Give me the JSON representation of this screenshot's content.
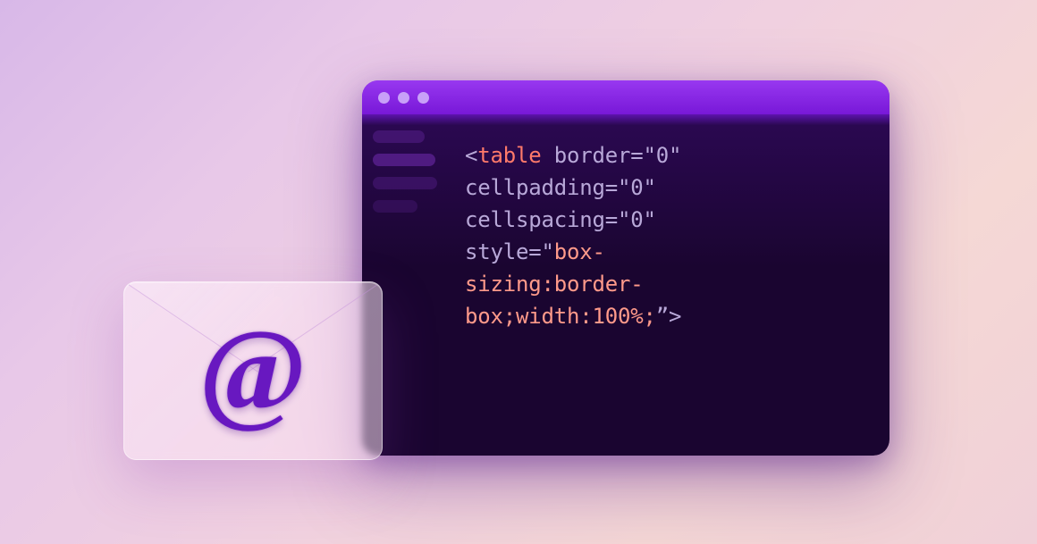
{
  "envelope": {
    "symbol": "@"
  },
  "code": {
    "line1": {
      "open": "<",
      "tag": "table",
      "sp1": " ",
      "attr1": "border",
      "eq": "=",
      "q": "\"",
      "val1": "0",
      "q2": "\""
    },
    "line2": {
      "attr": "cellpadding",
      "eq": "=",
      "q": "\"",
      "val": "0",
      "q2": "\""
    },
    "line3": {
      "attr": "cellspacing",
      "eq": "=",
      "q": "\"",
      "val": "0",
      "q2": "\""
    },
    "line4": {
      "attr": "style",
      "eq": "=",
      "q": "\"",
      "val": "box-"
    },
    "line5": {
      "val": "sizing:border-"
    },
    "line6": {
      "val": "box;width:100%;",
      "q": "”",
      "close": ">"
    }
  }
}
